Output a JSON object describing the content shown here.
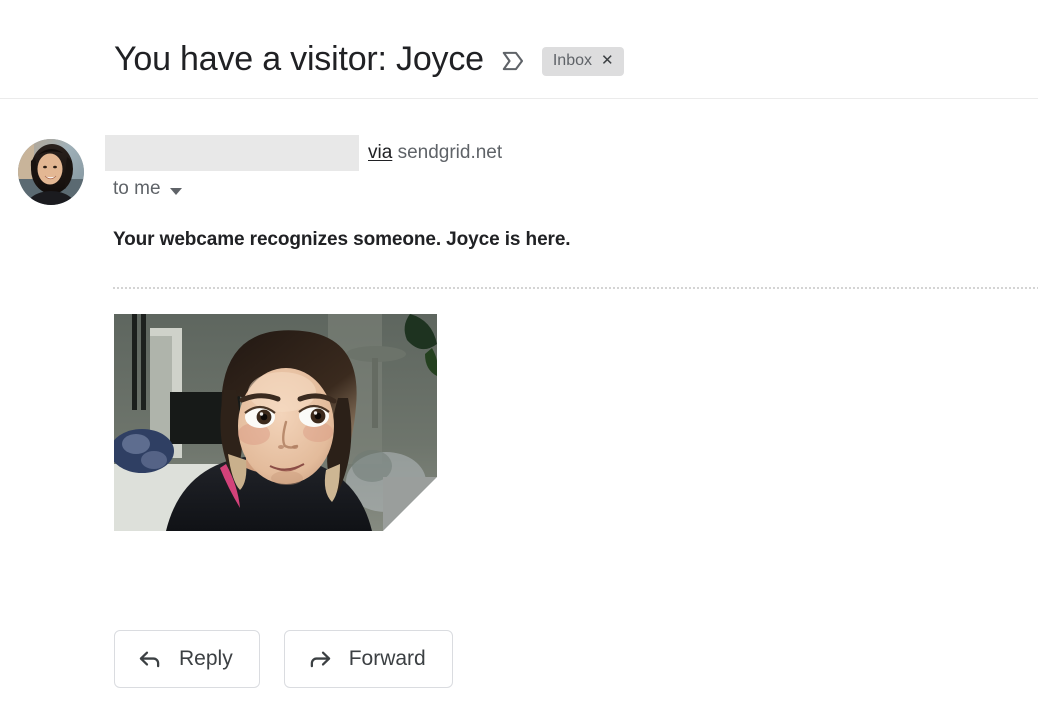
{
  "header": {
    "subject": "You have a visitor: Joyce",
    "important_marker_icon": "important-chevron-icon",
    "label": {
      "name": "Inbox",
      "remove_icon": "close-x-icon"
    }
  },
  "sender": {
    "avatar_icon": "sender-avatar-photo",
    "name_redacted": "",
    "via_label": "via",
    "via_domain": "sendgrid.net",
    "recipient": "to me",
    "recipient_expand_icon": "chevron-down-icon"
  },
  "message": {
    "body_text": "Your webcame recognizes someone. Joyce is here.",
    "attachment": {
      "image_alt": "webcam-snapshot",
      "fold_corner_icon": "folded-corner-icon"
    }
  },
  "actions": [
    {
      "label": "Reply",
      "icon": "reply-arrow-icon"
    },
    {
      "label": "Forward",
      "icon": "forward-arrow-icon"
    }
  ],
  "colors": {
    "text_primary": "#202124",
    "text_secondary": "#5f6368",
    "chip_background": "#ddddde",
    "redaction": "#e8e8e8",
    "border": "#dadce0",
    "rule": "#ebebeb",
    "divider_dots": "#d4d4d4",
    "page_background": "#ffffff"
  }
}
